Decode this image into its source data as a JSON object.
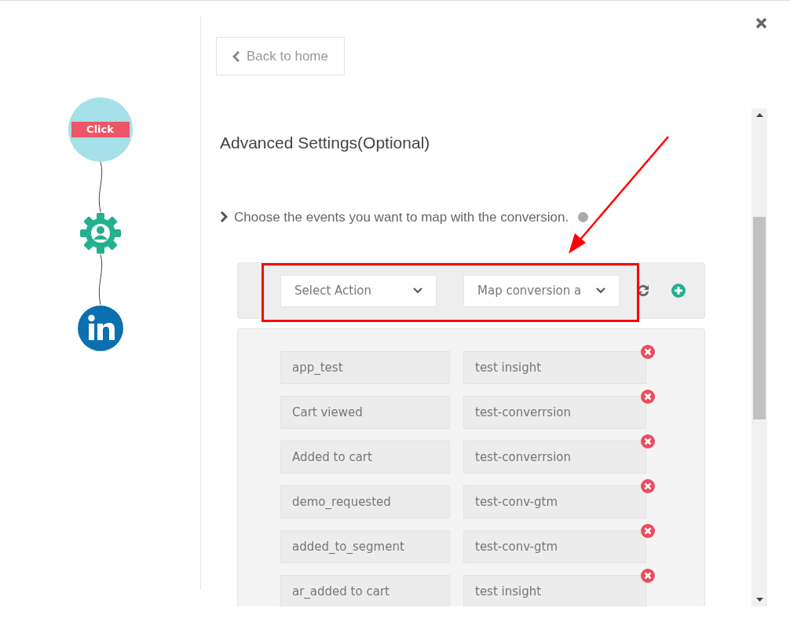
{
  "flow": {
    "steps": [
      {
        "kind": "trigger",
        "label": "Click"
      },
      {
        "kind": "gear"
      },
      {
        "kind": "linkedin"
      }
    ]
  },
  "back_button": {
    "label": "Back to home"
  },
  "section": {
    "title": "Advanced Settings(Optional)",
    "description": "Choose the events you want to map with the conversion."
  },
  "selectors": [
    {
      "value": "Select Action"
    },
    {
      "value": "Map conversion a"
    }
  ],
  "mappings": [
    {
      "event": "app_test",
      "conversion": "test insight"
    },
    {
      "event": "Cart viewed",
      "conversion": "test-converrsion"
    },
    {
      "event": "Added to cart",
      "conversion": "test-converrsion"
    },
    {
      "event": "demo_requested",
      "conversion": "test-conv-gtm"
    },
    {
      "event": "added_to_segment",
      "conversion": "test-conv-gtm"
    },
    {
      "event": "ar_added to cart",
      "conversion": "test insight"
    }
  ]
}
